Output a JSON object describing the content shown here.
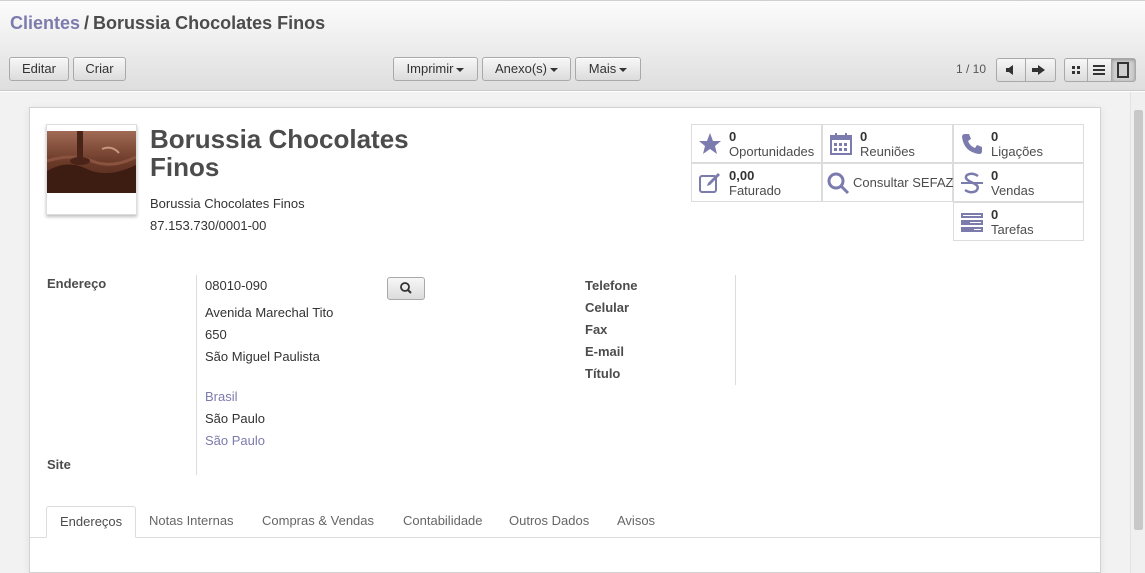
{
  "breadcrumb": {
    "parent": "Clientes",
    "separator": "/",
    "current": "Borussia Chocolates Finos"
  },
  "toolbar": {
    "edit_label": "Editar",
    "create_label": "Criar",
    "print_label": "Imprimir",
    "attachments_label": "Anexo(s)",
    "more_label": "Mais"
  },
  "pager": {
    "value": "1 / 10"
  },
  "views": [
    "kanban",
    "list",
    "form"
  ],
  "partner": {
    "name": "Borussia Chocolates Finos",
    "company_name": "Borussia Chocolates Finos",
    "cnpj": "87.153.730/0001-00"
  },
  "smart_buttons": [
    {
      "count": "0",
      "label": "Oportunidades",
      "icon": "star-icon"
    },
    {
      "count": "0",
      "label": "Reuniões",
      "icon": "calendar-icon"
    },
    {
      "count": "0",
      "label": "Ligações",
      "icon": "phone-icon"
    },
    {
      "count": "0,00",
      "label": "Faturado",
      "icon": "edit-icon"
    },
    {
      "label": "Consultar SEFAZ",
      "icon": "search-icon"
    },
    {
      "count": "0",
      "label": "Vendas",
      "icon": "strikethrough-icon"
    },
    {
      "count": "0",
      "label": "Tarefas",
      "icon": "tasks-icon"
    }
  ],
  "address": {
    "label": "Endereço",
    "zip": "08010-090",
    "street": "Avenida Marechal Tito",
    "number": "650",
    "district": "São Miguel Paulista",
    "country": "Brasil",
    "state": "São Paulo",
    "city": "São Paulo"
  },
  "site_label": "Site",
  "contact_labels": {
    "phone": "Telefone",
    "mobile": "Celular",
    "fax": "Fax",
    "email": "E-mail",
    "title": "Título"
  },
  "tabs": [
    "Endereços",
    "Notas Internas",
    "Compras & Vendas",
    "Contabilidade",
    "Outros Dados",
    "Avisos"
  ],
  "colors": {
    "accent": "#7c7bad",
    "text": "#4c4c4c"
  }
}
